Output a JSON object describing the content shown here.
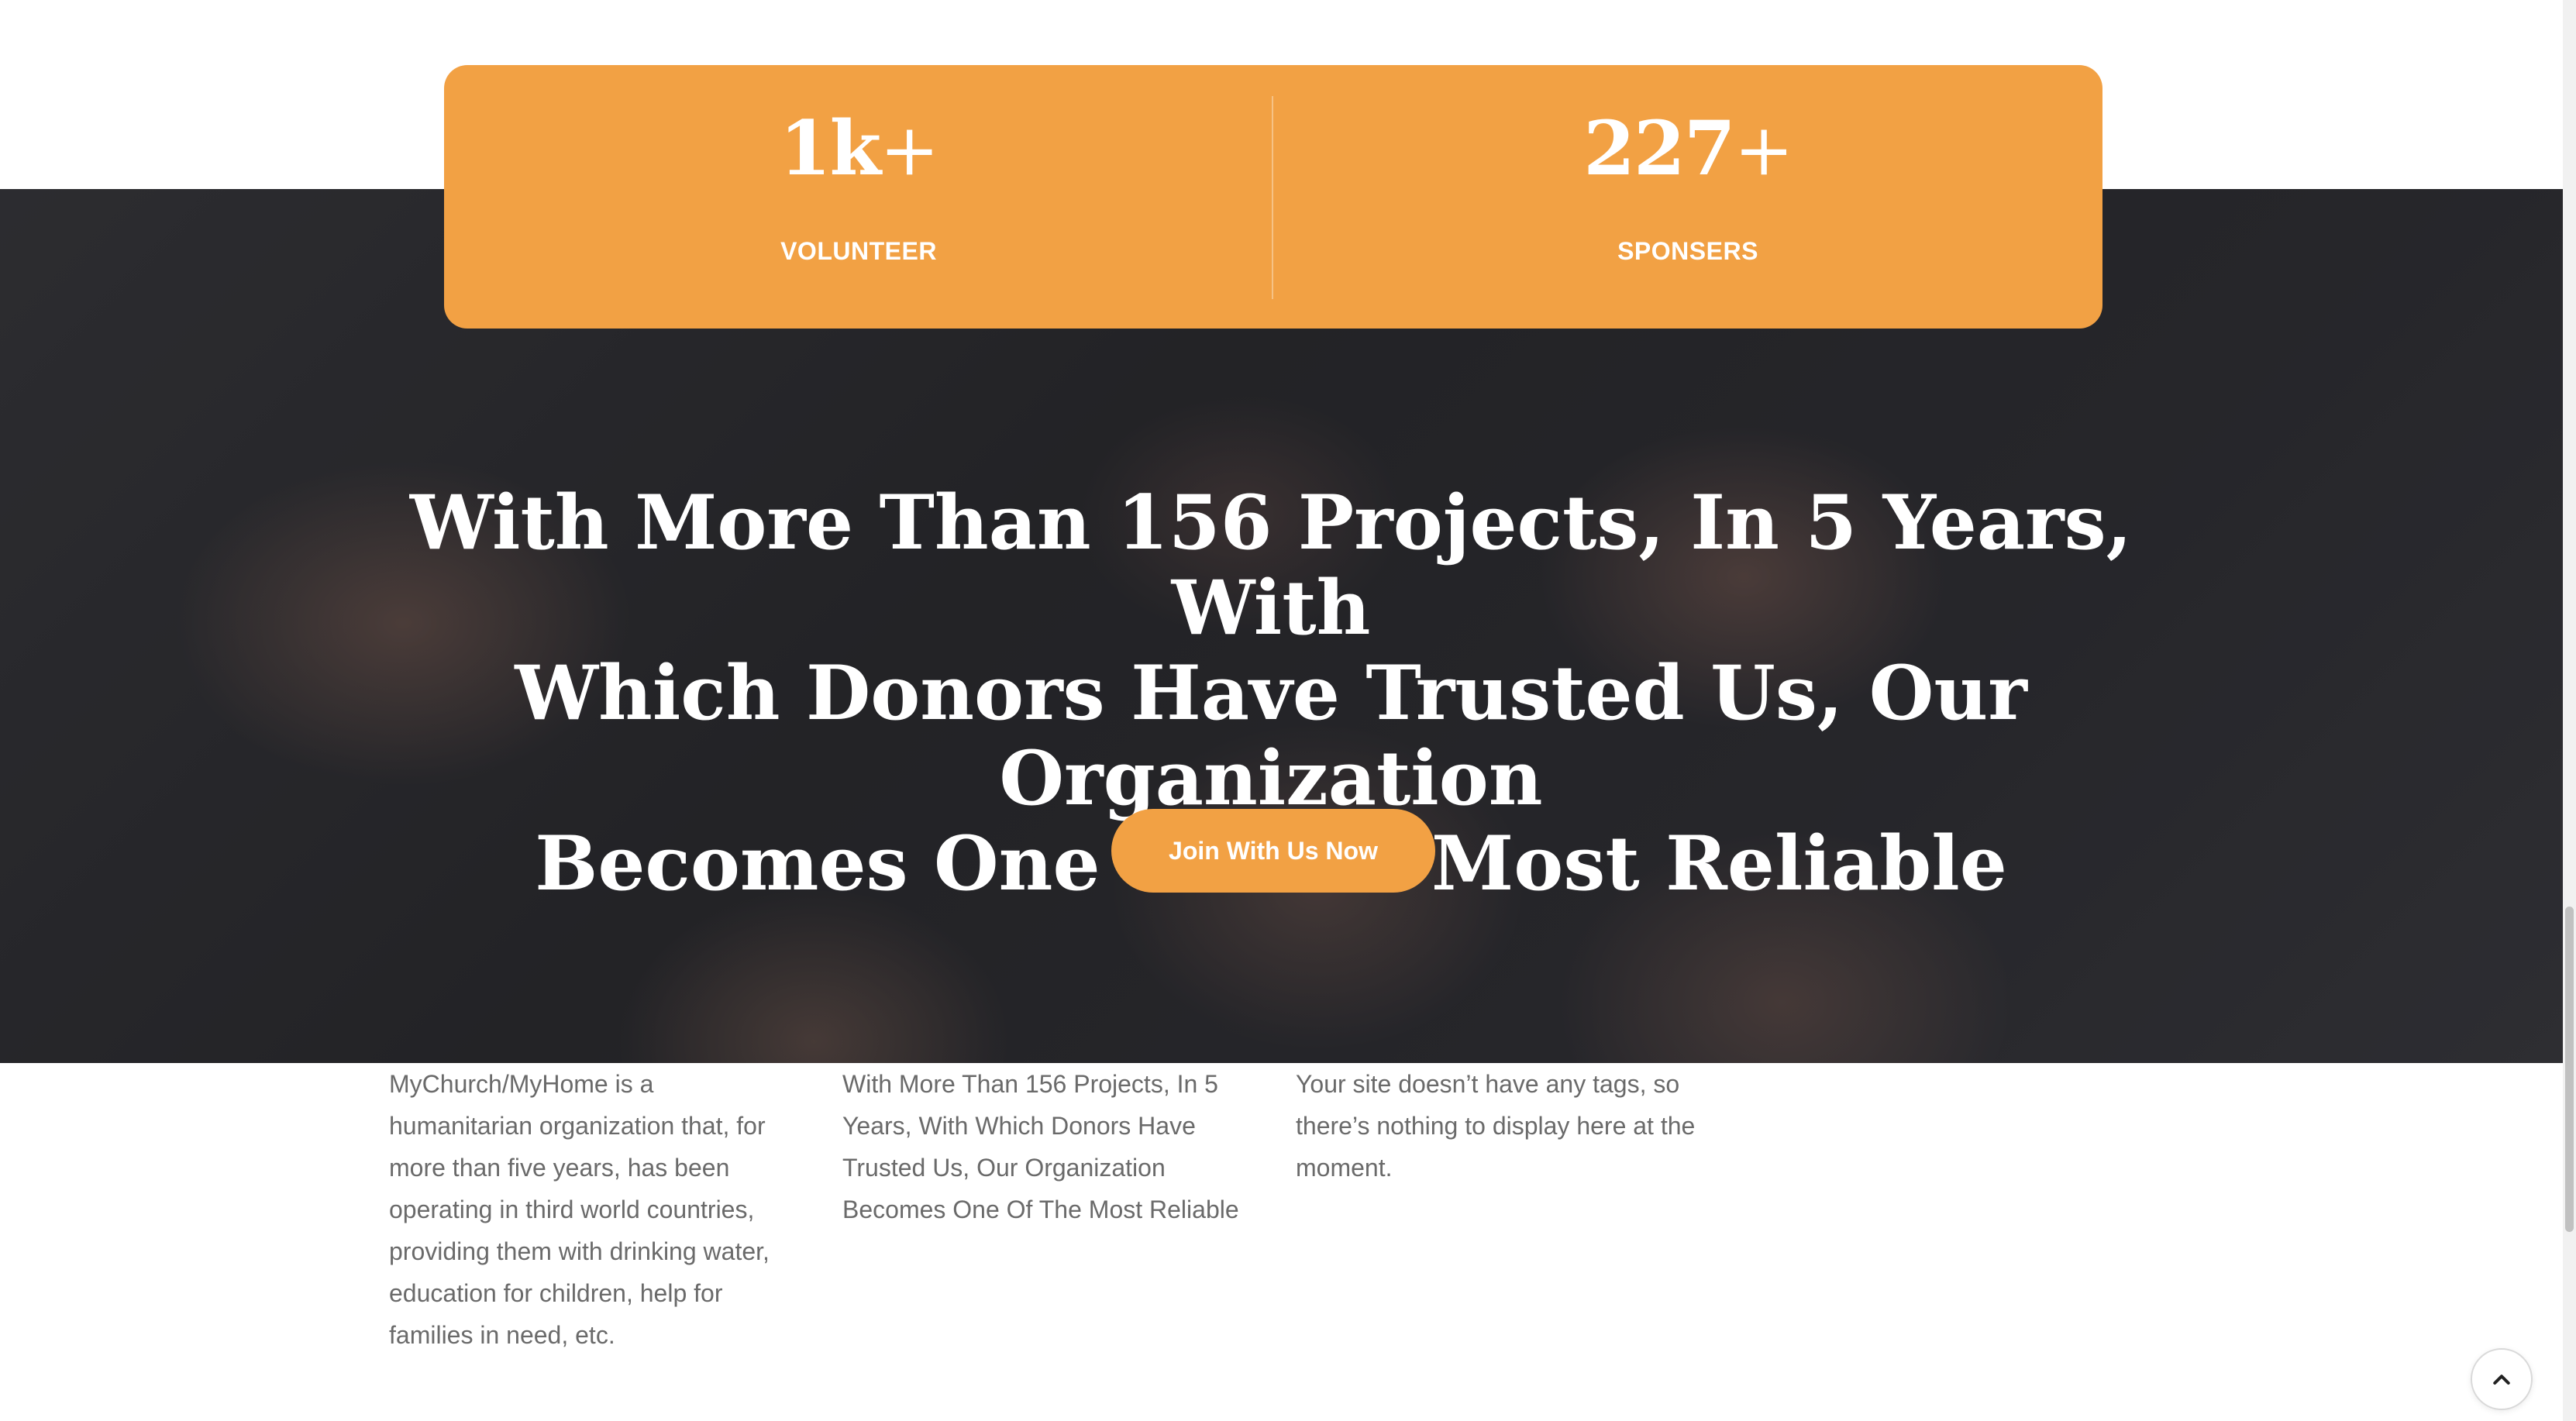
{
  "stats": [
    {
      "number": "1k",
      "suffix": "+",
      "label": "VOLUNTEER"
    },
    {
      "number": "227",
      "suffix": "+",
      "label": "SPONSERS"
    }
  ],
  "hero": {
    "headline_lines": [
      "With More Than 156 Projects, In 5 Years, With",
      "Which Donors Have Trusted Us, Our Organization",
      "Becomes One Of The Most Reliable"
    ],
    "cta_label": "Join With Us Now"
  },
  "footer": {
    "about": "MyChurch/MyHome is a humanitarian organization that, for more than five years, has been operating in third world countries, providing them with drinking water, education for children, help for families in need, etc.",
    "mission": "With More Than 156 Projects, In 5 Years, With Which Donors Have Trusted Us, Our Organization Becomes One Of The Most Reliable",
    "tags_message": "Your site doesn’t have any tags, so there’s nothing to display here at the moment."
  },
  "colors": {
    "accent": "#f2a144",
    "hero_overlay": "#2b2b2f",
    "body_text": "#6a6a6a"
  },
  "icons": {
    "back_to_top": "chevron-up-icon"
  }
}
